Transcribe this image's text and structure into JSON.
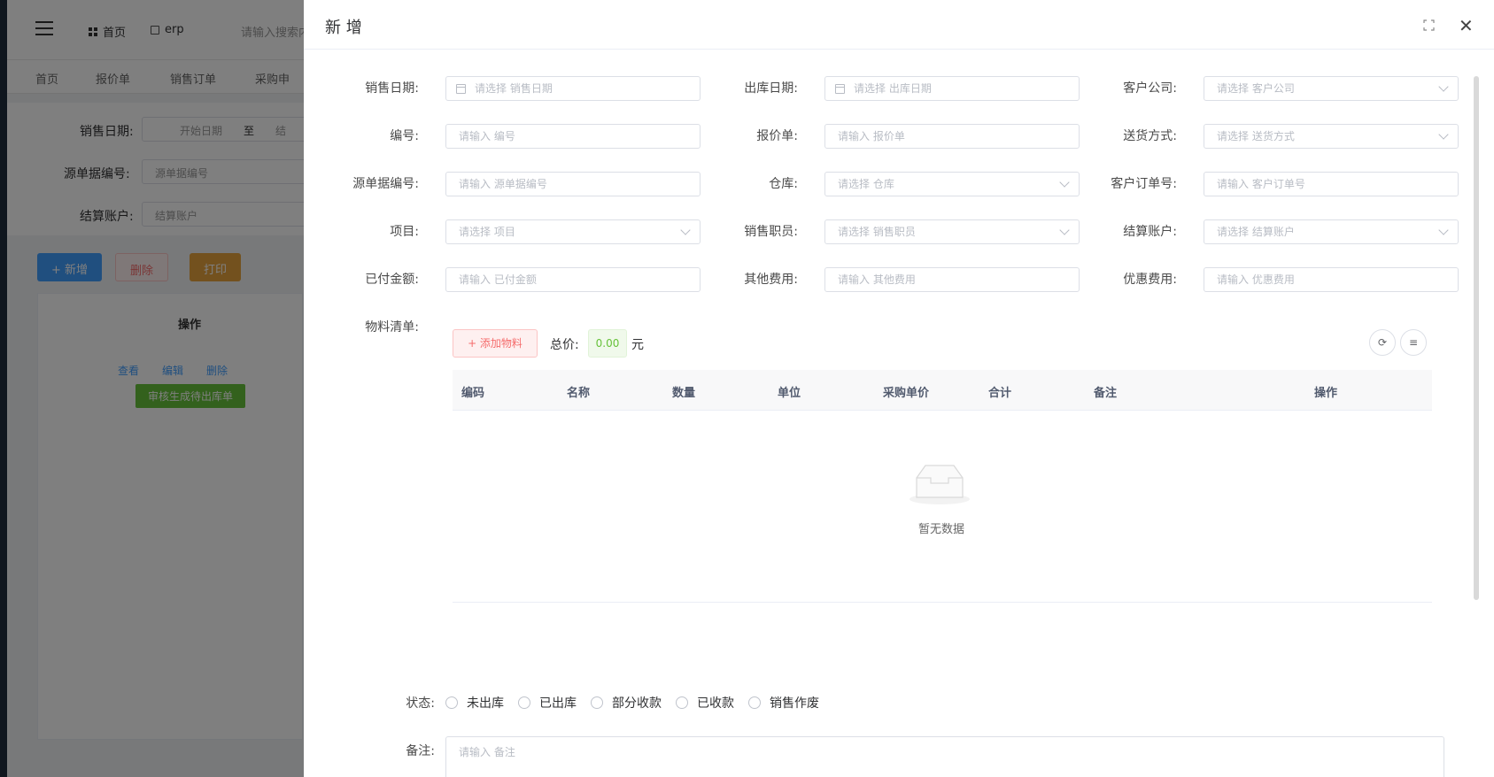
{
  "background": {
    "nav": {
      "home": "首页",
      "erp": "erp",
      "search_placeholder": "请输入搜索内"
    },
    "tags": [
      "首页",
      "报价单",
      "销售订单",
      "采购申"
    ],
    "form": {
      "sale_date_label": "销售日期:",
      "start_date": "开始日期",
      "to": "至",
      "end_partial": "结",
      "source_no_label": "源单据编号:",
      "source_no_placeholder": "源单据编号",
      "account_label": "结算账户:",
      "account_placeholder": "结算账户"
    },
    "buttons": {
      "add": "+ 新增",
      "delete": "删除",
      "print": "打印"
    },
    "table": {
      "op_header": "操作",
      "view": "查看",
      "edit": "编辑",
      "del": "删除",
      "audit": "审核生成待出库单"
    }
  },
  "drawer": {
    "title": "新 增",
    "fields": [
      {
        "label": "销售日期:",
        "placeholder": "请选择 销售日期",
        "kind": "date"
      },
      {
        "label": "出库日期:",
        "placeholder": "请选择 出库日期",
        "kind": "date"
      },
      {
        "label": "客户公司:",
        "placeholder": "请选择 客户公司",
        "kind": "select"
      },
      {
        "label": "编号:",
        "placeholder": "请输入 编号",
        "kind": "text"
      },
      {
        "label": "报价单:",
        "placeholder": "请输入 报价单",
        "kind": "text"
      },
      {
        "label": "送货方式:",
        "placeholder": "请选择 送货方式",
        "kind": "select"
      },
      {
        "label": "源单据编号:",
        "placeholder": "请输入 源单据编号",
        "kind": "text"
      },
      {
        "label": "仓库:",
        "placeholder": "请选择 仓库",
        "kind": "select"
      },
      {
        "label": "客户订单号:",
        "placeholder": "请输入 客户订单号",
        "kind": "text"
      },
      {
        "label": "项目:",
        "placeholder": "请选择 项目",
        "kind": "select"
      },
      {
        "label": "销售职员:",
        "placeholder": "请选择 销售职员",
        "kind": "select"
      },
      {
        "label": "结算账户:",
        "placeholder": "请选择 结算账户",
        "kind": "select"
      },
      {
        "label": "已付金额:",
        "placeholder": "请输入 已付金额",
        "kind": "text"
      },
      {
        "label": "其他费用:",
        "placeholder": "请输入 其他费用",
        "kind": "text"
      },
      {
        "label": "优惠费用:",
        "placeholder": "请输入 优惠费用",
        "kind": "text"
      }
    ],
    "materials": {
      "label": "物料清单:",
      "add_button": "+ 添加物料",
      "total_label": "总价:",
      "total_value": "0.00",
      "total_unit": "元",
      "columns": [
        "编码",
        "名称",
        "数量",
        "单位",
        "采购单价",
        "合计",
        "备注",
        "操作"
      ],
      "empty_text": "暂无数据"
    },
    "status": {
      "label": "状态:",
      "options": [
        "未出库",
        "已出库",
        "部分收款",
        "已收款",
        "销售作废"
      ]
    },
    "remark": {
      "label": "备注:",
      "placeholder": "请输入 备注"
    }
  }
}
